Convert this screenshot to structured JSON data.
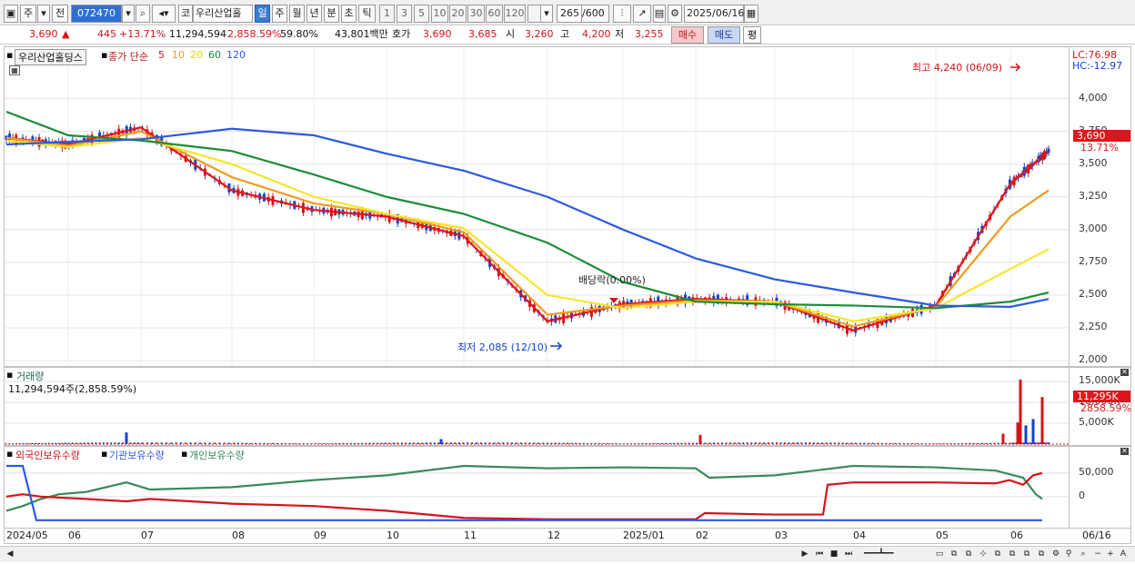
{
  "toolbar": {
    "market_label": "주",
    "prev_label": "전",
    "code": "072470",
    "stock_name": "우리산업홀",
    "name_prefix": "코",
    "periods": [
      "일",
      "주",
      "월",
      "년",
      "분",
      "초",
      "틱"
    ],
    "intervals": [
      "1",
      "3",
      "5",
      "10",
      "20",
      "30",
      "60",
      "120"
    ],
    "count": "265",
    "count_max": "/600",
    "date": "2025/06/16"
  },
  "quote": {
    "price": "3,690",
    "direction": "▲",
    "change": "445",
    "change_pct": "+13.71%",
    "volume": "11,294,594",
    "volume_ratio": "2,858.59%",
    "turnover": "59.80%",
    "amount": "43,801백만",
    "quote_label": "호가",
    "ask": "3,690",
    "bid": "3,685",
    "open_label": "시",
    "open": "3,260",
    "high_label": "고",
    "high": "4,200",
    "low_label": "저",
    "low": "3,255",
    "buy_label": "매수",
    "sell_label": "매도",
    "avg_label": "평"
  },
  "price_panel": {
    "name": "우리산업홀딩스",
    "ma_title": "종가 단순",
    "ma_periods": [
      "5",
      "10",
      "20",
      "60",
      "120"
    ],
    "lc": "LC:76.98",
    "hc": "HC:-12.97",
    "current_price": "3,690",
    "current_pct": "13.71%",
    "high_note": "최고 4,240 (06/09)",
    "low_note": "최저 2,085 (12/10)",
    "dividend_note": "배당락(0.00%)",
    "y_ticks": [
      "4,000",
      "3,750",
      "3,500",
      "3,250",
      "3,000",
      "2,750",
      "2,500",
      "2,250",
      "2,000"
    ]
  },
  "volume_panel": {
    "title": "거래량",
    "value": "11,294,594주(2,858.59%)",
    "current": "11,295K",
    "current_pct": "2858.59%",
    "y_ticks": [
      "15,000K",
      "10,000K",
      "5,000K"
    ]
  },
  "holding_panel": {
    "series_labels": [
      "외국인보유수량",
      "기관보유수량",
      "개인보유수량"
    ],
    "y_ticks": [
      "50,000",
      "0"
    ]
  },
  "x_axis": [
    "2024/05",
    "06",
    "07",
    "08",
    "09",
    "10",
    "11",
    "12",
    "2025/01",
    "02",
    "03",
    "04",
    "05",
    "06"
  ],
  "x_axis_end": "06/16",
  "chart_data": {
    "type": "line",
    "title": "우리산업홀딩스",
    "x": [
      "2024/05",
      "06",
      "07",
      "08",
      "09",
      "10",
      "11",
      "12",
      "2025/01",
      "02",
      "03",
      "04",
      "05",
      "06",
      "06/16"
    ],
    "series": [
      {
        "name": "5",
        "values": [
          3700,
          3650,
          3780,
          3300,
          3150,
          3100,
          2950,
          2300,
          2430,
          2470,
          2450,
          2230,
          2420,
          3350,
          3600
        ]
      },
      {
        "name": "10",
        "values": [
          3700,
          3640,
          3750,
          3400,
          3200,
          3120,
          2980,
          2350,
          2420,
          2460,
          2450,
          2260,
          2410,
          3100,
          3300
        ]
      },
      {
        "name": "20",
        "values": [
          3680,
          3630,
          3700,
          3500,
          3250,
          3120,
          3010,
          2500,
          2400,
          2450,
          2450,
          2300,
          2400,
          2700,
          2850
        ]
      },
      {
        "name": "60",
        "values": [
          3900,
          3720,
          3680,
          3600,
          3420,
          3250,
          3120,
          2900,
          2600,
          2450,
          2430,
          2420,
          2400,
          2450,
          2520
        ]
      },
      {
        "name": "120",
        "values": [
          3650,
          3670,
          3690,
          3770,
          3720,
          3580,
          3450,
          3250,
          3000,
          2780,
          2620,
          2520,
          2420,
          2410,
          2470
        ]
      }
    ],
    "price_ylim": [
      2000,
      4240
    ],
    "volume_spikes_k": {
      "07": 2800,
      "2025/01 (02)": 2200,
      "06": 15500,
      "06/16": 11295
    },
    "holding_ylim": [
      -60000,
      90000
    ],
    "legend": "top-left",
    "grid": true
  },
  "colors": {
    "ma5": "#e0161c",
    "ma10": "#f29a1a",
    "ma20": "#f5e62b",
    "ma60": "#1c8c3a",
    "ma120": "#2b5ae0",
    "foreign": "#d4131a",
    "institution": "#2b5ae0",
    "individual": "#3a8a5a",
    "up": "#d4131a",
    "down": "#1442c8"
  }
}
